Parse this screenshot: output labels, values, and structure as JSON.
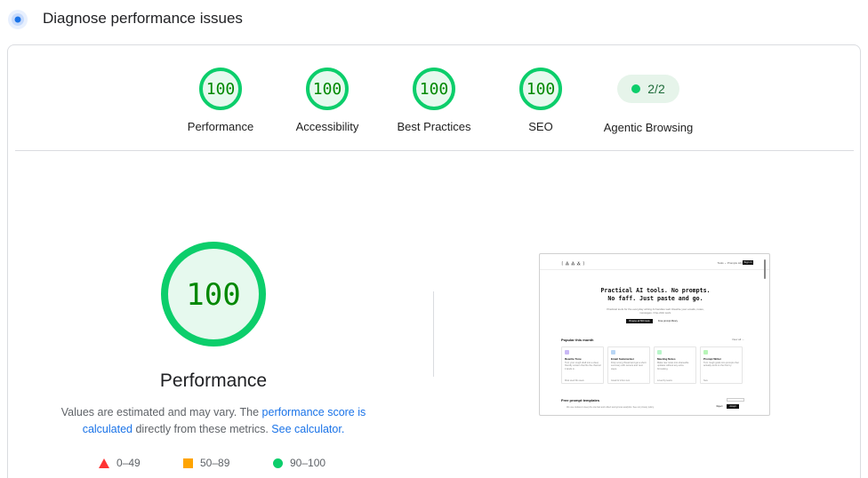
{
  "header": {
    "title": "Diagnose performance issues",
    "icon": "lighthouse-diagnose-icon",
    "icon_color": "#1a73e8"
  },
  "categories": [
    {
      "label": "Performance",
      "score": "100"
    },
    {
      "label": "Accessibility",
      "score": "100"
    },
    {
      "label": "Best Practices",
      "score": "100"
    },
    {
      "label": "SEO",
      "score": "100"
    }
  ],
  "agentic": {
    "label": "Agentic Browsing",
    "value": "2/2"
  },
  "main": {
    "score": "100",
    "title": "Performance",
    "desc_part1": "Values are estimated and may vary. The ",
    "desc_link1": "performance score is calculated",
    "desc_part2": " directly from these metrics. ",
    "desc_link2": "See calculator."
  },
  "legend": [
    {
      "icon": "fail-triangle-icon",
      "label": "0–49",
      "color": "#ff3333"
    },
    {
      "icon": "average-square-icon",
      "label": "50–89",
      "color": "#ffa400"
    },
    {
      "icon": "pass-circle-icon",
      "label": "90–100",
      "color": "#0cce6b"
    }
  ],
  "colors": {
    "pass": "#0cce6b",
    "pass_text": "#008800",
    "pass_fill": "#e6f9ee",
    "link": "#1a73e8"
  },
  "screenshot": {
    "logo": "[ ⁂ ⁂ ⁂ ]",
    "nav_links": "Tools ⌄   Prompts   Library",
    "nav_button": "Sign in",
    "hero_line1": "Practical AI tools. No prompts.",
    "hero_line2": "No faff. Just paste and go.",
    "hero_sub": "Practical tools for the everyday writing AI handles well. Rewrite your emails, notes, messages. One-click work.",
    "cta_primary": "Browse all 500 tools",
    "cta_secondary": "Free prompt library",
    "section_title": "Popular this month",
    "view_all": "View all →",
    "cards": [
      {
        "title": "Rewrite Tone",
        "desc": "Turn your rough draft into a clear, friendly version that fits the channel it lands in.",
        "footer": "Most used this week",
        "color": "#c9b8f5"
      },
      {
        "title": "Email Summarizer",
        "desc": "Drop a long thread and get a short summary with owners and next steps.",
        "footer": "Great for inbox zero",
        "color": "#b8d6f5"
      },
      {
        "title": "Meeting Notes",
        "desc": "Make raw notes into shareable updates without any extra formatting.",
        "footer": "Loved by teams",
        "color": "#b8f5c9"
      },
      {
        "title": "Prompt Writer",
        "desc": "Turn rough goals into prompts that actually work on the first try.",
        "footer": "New",
        "color": "#b8f5b8"
      }
    ],
    "section2_title": "Free prompt templates",
    "footer_text": "We use cookies to keep the site fast and collect anonymous analytics. See our privacy policy.",
    "footer_btn1": "Reject",
    "footer_btn2": "Accept"
  }
}
